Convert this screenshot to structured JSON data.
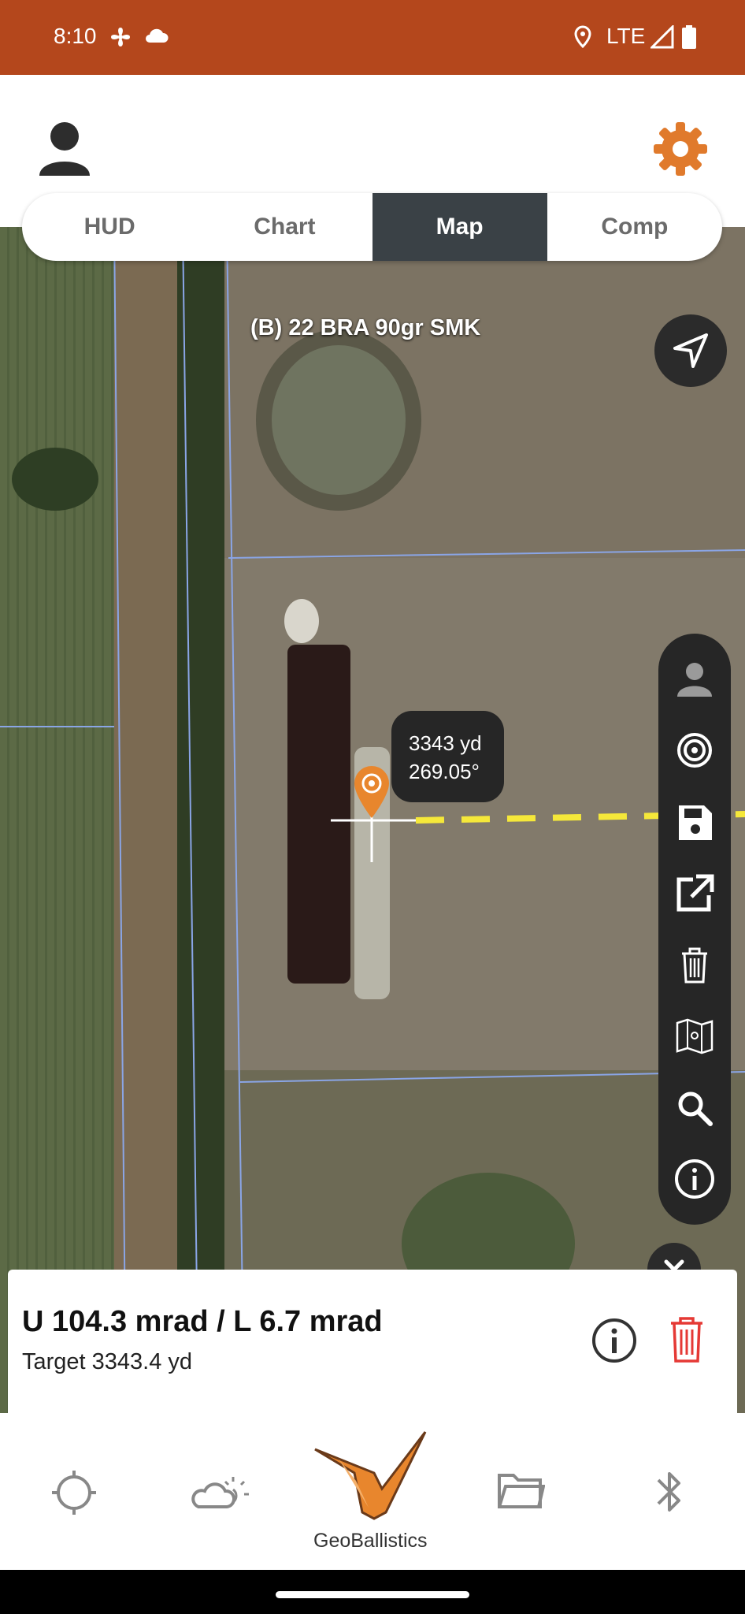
{
  "status_bar": {
    "time": "8:10",
    "network": "LTE"
  },
  "tabs": [
    {
      "label": "HUD",
      "active": false
    },
    {
      "label": "Chart",
      "active": false
    },
    {
      "label": "Map",
      "active": true
    },
    {
      "label": "Comp",
      "active": false
    }
  ],
  "map": {
    "profile_label": "(B) 22 BRA 90gr SMK",
    "target_tooltip": {
      "distance": "3343 yd",
      "bearing": "269.05°"
    }
  },
  "toolbar": {
    "icons": [
      "person-icon",
      "target-icon",
      "save-icon",
      "share-icon",
      "trash-icon",
      "map-icon",
      "search-icon",
      "info-icon"
    ]
  },
  "solution_panel": {
    "headline": "U 104.3 mrad / L 6.7 mrad",
    "subline": "Target 3343.4 yd"
  },
  "bottom_nav": {
    "brand": "GeoBallistics",
    "items": [
      "crosshair-icon",
      "weather-icon",
      "logo",
      "folder-icon",
      "bluetooth-icon"
    ]
  },
  "colors": {
    "accent": "#e07a2c",
    "status_bar": "#b4471c",
    "danger": "#e53935",
    "dark": "#262626"
  }
}
